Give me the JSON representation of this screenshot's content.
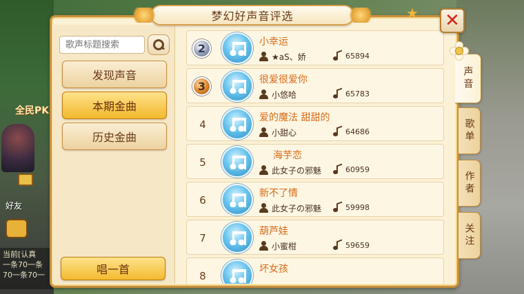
{
  "background": {
    "pk_text": "全民PK",
    "friend_text": "好友",
    "chat_log": [
      "当前[认真",
      "一条70一条",
      "70一条70一"
    ]
  },
  "window": {
    "title": "梦幻好声音评选",
    "close_label": "✕"
  },
  "search": {
    "placeholder": "歌声标题搜索"
  },
  "nav": {
    "discover": "发现声音",
    "current": "本期金曲",
    "history": "历史金曲"
  },
  "sing_button": "唱一首",
  "tabs": [
    "声音",
    "歌单",
    "作者",
    "关注"
  ],
  "songs": [
    {
      "rank": "2",
      "title": "小幸运",
      "singer": "★aS、娇",
      "score": "65894"
    },
    {
      "rank": "3",
      "title": "很爱很爱你",
      "singer": "小悠哈",
      "score": "65783"
    },
    {
      "rank": "4",
      "title": "爱的魔法 甜甜的",
      "singer": "小甜心",
      "score": "64686"
    },
    {
      "rank": "5",
      "title": "海芋恋",
      "singer": "此女子の邪魅",
      "score": "60959"
    },
    {
      "rank": "6",
      "title": "新不了情",
      "singer": "此女子の邪魅",
      "score": "59998"
    },
    {
      "rank": "7",
      "title": "葫芦娃",
      "singer": "小蜜柑",
      "score": "59659"
    },
    {
      "rank": "8",
      "title": "坏女孩",
      "singer": "",
      "score": ""
    }
  ],
  "colors": {
    "accent_orange": "#d86a16",
    "panel_bg": "#fbf1d6",
    "active_gold": "#f2b92d",
    "close_red": "#d7261b"
  }
}
